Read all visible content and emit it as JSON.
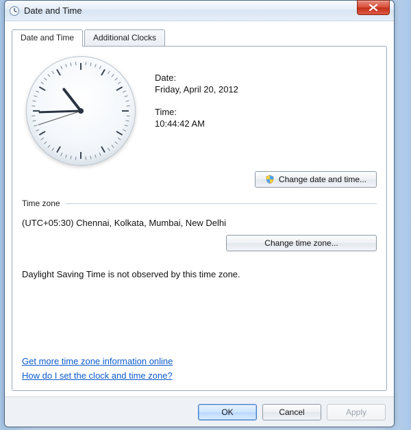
{
  "window": {
    "title": "Date and Time"
  },
  "tabs": [
    {
      "label": "Date and Time",
      "active": true
    },
    {
      "label": "Additional Clocks",
      "active": false
    }
  ],
  "datetime": {
    "date_label": "Date:",
    "date_value": "Friday, April 20, 2012",
    "time_label": "Time:",
    "time_value": "10:44:42 AM",
    "hour": 10,
    "minute": 44,
    "second": 42,
    "change_dt_label": "Change date and time..."
  },
  "timezone": {
    "group_label": "Time zone",
    "current": "(UTC+05:30) Chennai, Kolkata, Mumbai, New Delhi",
    "change_tz_label": "Change time zone...",
    "dst_note": "Daylight Saving Time is not observed by this time zone."
  },
  "links": {
    "more_info": "Get more time zone information online",
    "how_to": "How do I set the clock and time zone?"
  },
  "buttons": {
    "ok": "OK",
    "cancel": "Cancel",
    "apply": "Apply"
  }
}
